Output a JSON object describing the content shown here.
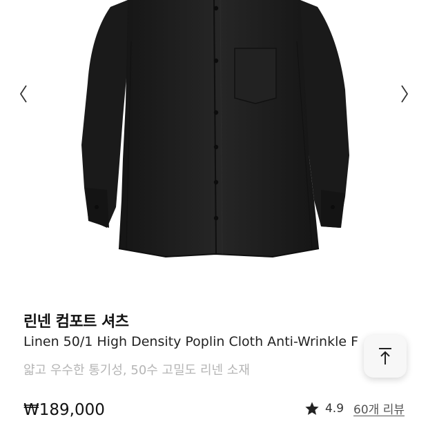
{
  "product": {
    "name_ko": "린넨 컴포트 셔츠",
    "name_en": "Linen 50/1 High Density Poplin Cloth Anti-Wrinkle F",
    "description": "얇고 우수한 통기성, 50수 고밀도 리넨 소재",
    "price": "₩189,000",
    "rating": "4.9",
    "reviews": "60개 리뷰"
  },
  "carousel": {
    "prev_icon": "chevron-left-icon",
    "next_icon": "chevron-right-icon"
  },
  "controls": {
    "scroll_top_icon": "arrow-up-to-top-icon"
  },
  "colors": {
    "shirt": "#1c1c1c",
    "muted_text": "#b5b5b5",
    "text": "#111111"
  }
}
